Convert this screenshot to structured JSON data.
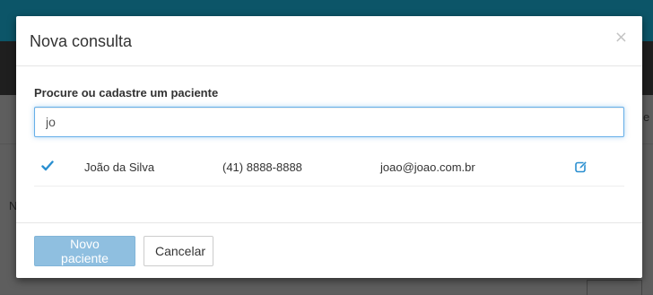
{
  "modal": {
    "title": "Nova consulta",
    "close_glyph": "×"
  },
  "search": {
    "label": "Procure ou cadastre um paciente",
    "value": "jo",
    "placeholder": ""
  },
  "results": [
    {
      "selected": true,
      "name": "João da Silva",
      "phone": "(41) 8888-8888",
      "email": "joao@joao.com.br",
      "check_icon": "check-icon",
      "edit_icon": "edit-icon"
    }
  ],
  "footer": {
    "new_patient_label": "Novo paciente",
    "cancel_label": "Cancelar"
  },
  "background": {
    "left_fragment": "N",
    "right_fragment": "e"
  },
  "colors": {
    "accent": "#2a8fd0",
    "primary_button": "#8fbfe0",
    "topbar": "#0c5568"
  }
}
